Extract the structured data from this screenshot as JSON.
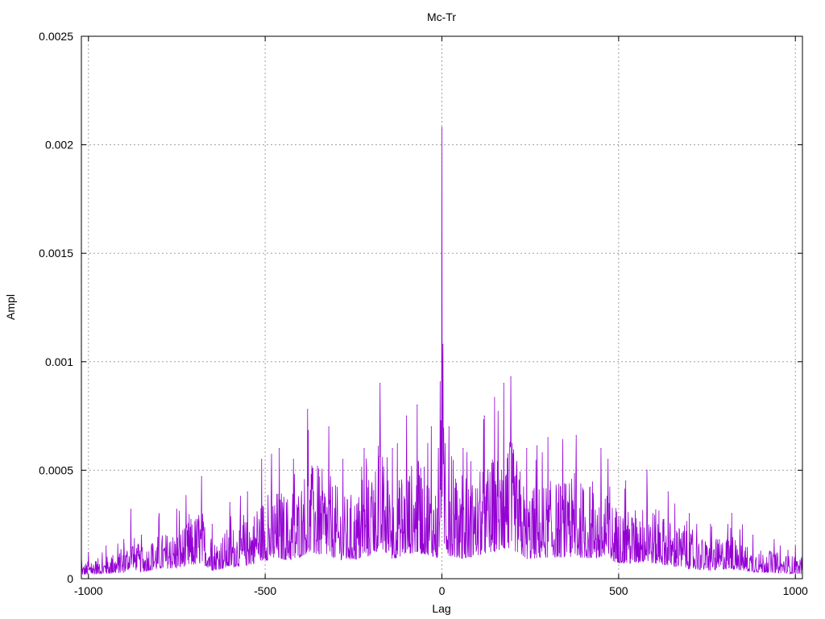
{
  "chart_data": {
    "type": "line",
    "title": "Mc-Tr",
    "xlabel": "Lag",
    "ylabel": "Ampl",
    "xlim": [
      -1020,
      1020
    ],
    "ylim": [
      0,
      0.0025
    ],
    "x_ticks": [
      -1000,
      -500,
      0,
      500,
      1000
    ],
    "x_tick_labels": [
      "-1000",
      "-500",
      "0",
      "500",
      "1000"
    ],
    "y_ticks": [
      0,
      0.0005,
      0.001,
      0.0015,
      0.002,
      0.0025
    ],
    "y_tick_labels": [
      "0",
      "0.0005",
      "0.001",
      "0.0015",
      "0.002",
      "0.0025"
    ],
    "grid": true,
    "series": [
      {
        "color": "#9400d3",
        "points": [
          [
            -1020,
            0.0001
          ],
          [
            -1000,
            0.00012
          ],
          [
            -950,
            0.00015
          ],
          [
            -900,
            0.00018
          ],
          [
            -880,
            0.00032
          ],
          [
            -850,
            0.0002
          ],
          [
            -800,
            0.0003
          ],
          [
            -750,
            0.00032
          ],
          [
            -680,
            0.00047
          ],
          [
            -650,
            0.00025
          ],
          [
            -600,
            0.00035
          ],
          [
            -550,
            0.0004
          ],
          [
            -510,
            0.00055
          ],
          [
            -460,
            0.0006
          ],
          [
            -420,
            0.00055
          ],
          [
            -380,
            0.00078
          ],
          [
            -320,
            0.0007
          ],
          [
            -280,
            0.00055
          ],
          [
            -220,
            0.0006
          ],
          [
            -175,
            0.0009
          ],
          [
            -140,
            0.0006
          ],
          [
            -100,
            0.00075
          ],
          [
            -70,
            0.0008
          ],
          [
            -30,
            0.0007
          ],
          [
            -10,
            0.0006
          ],
          [
            0,
            0.00208
          ],
          [
            3,
            0.00108
          ],
          [
            20,
            0.0007
          ],
          [
            60,
            0.0006
          ],
          [
            120,
            0.00075
          ],
          [
            175,
            0.0009
          ],
          [
            195,
            0.00093
          ],
          [
            240,
            0.0006
          ],
          [
            300,
            0.00065
          ],
          [
            380,
            0.00066
          ],
          [
            450,
            0.0006
          ],
          [
            470,
            0.00055
          ],
          [
            520,
            0.00045
          ],
          [
            580,
            0.0005
          ],
          [
            640,
            0.0004
          ],
          [
            700,
            0.0003
          ],
          [
            760,
            0.00025
          ],
          [
            820,
            0.0003
          ],
          [
            880,
            0.0002
          ],
          [
            940,
            0.00018
          ],
          [
            1000,
            0.00015
          ],
          [
            1020,
            0.00014
          ]
        ]
      }
    ]
  },
  "colors": {
    "series_line": "#9400d3",
    "grid": "#a0a0a0",
    "axis": "#000000"
  }
}
